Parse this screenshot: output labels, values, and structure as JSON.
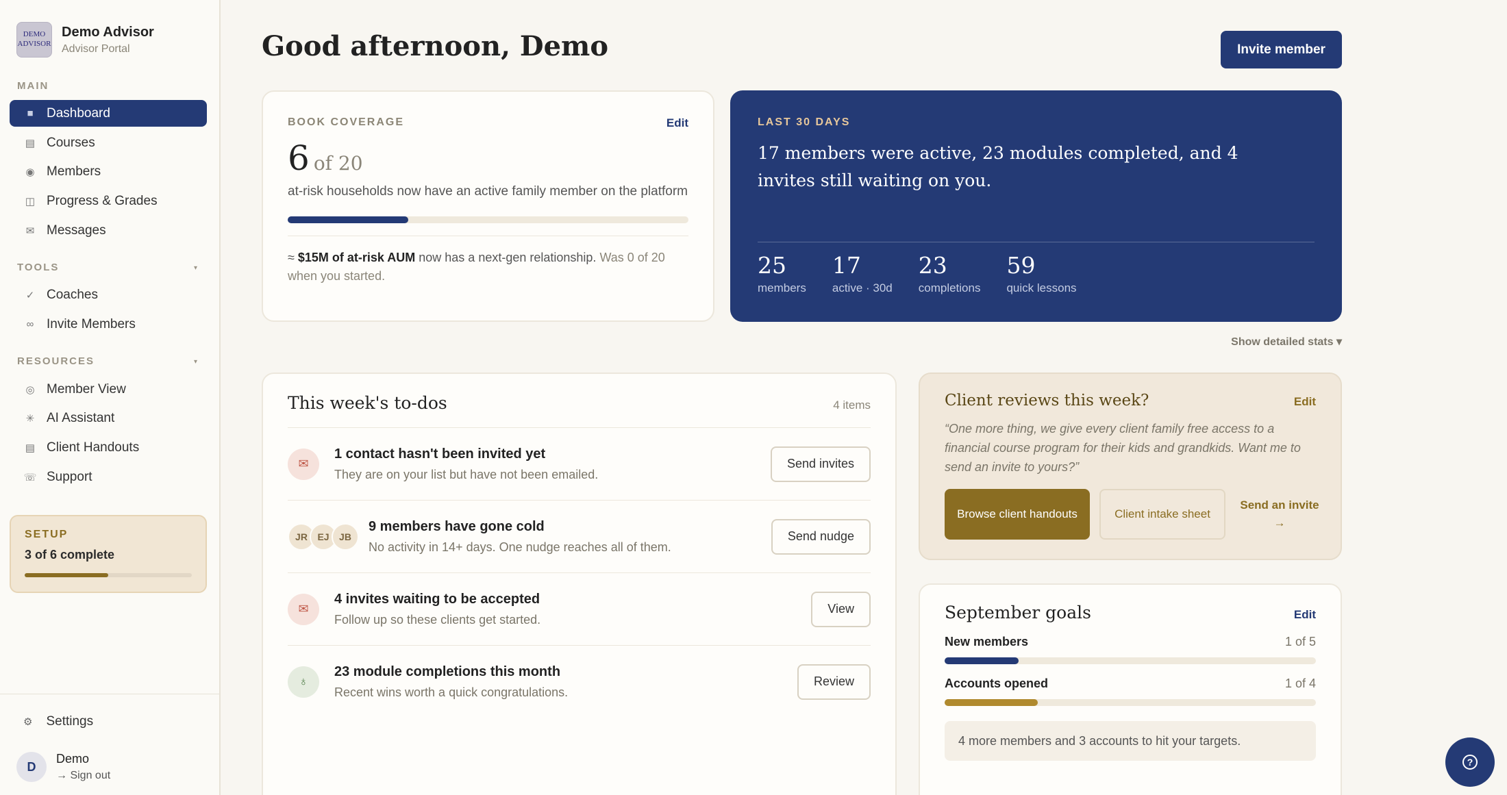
{
  "brand": {
    "logo_text": "DEMO ADVISOR",
    "name": "Demo Advisor",
    "subtitle": "Advisor Portal"
  },
  "sidebar": {
    "main_label": "MAIN",
    "main_items": [
      {
        "label": "Dashboard",
        "icon": "dashboard-icon",
        "active": true
      },
      {
        "label": "Courses",
        "icon": "courses-icon"
      },
      {
        "label": "Members",
        "icon": "members-icon"
      },
      {
        "label": "Progress & Grades",
        "icon": "progress-icon"
      },
      {
        "label": "Messages",
        "icon": "mail-icon"
      }
    ],
    "tools_label": "TOOLS",
    "tools_items": [
      {
        "label": "Coaches",
        "icon": "check-icon"
      },
      {
        "label": "Invite Members",
        "icon": "link-icon"
      }
    ],
    "resources_label": "RESOURCES",
    "resources_items": [
      {
        "label": "Member View",
        "icon": "circle-icon"
      },
      {
        "label": "AI Assistant",
        "icon": "sparkle-icon"
      },
      {
        "label": "Client Handouts",
        "icon": "document-icon"
      },
      {
        "label": "Support",
        "icon": "phone-icon"
      }
    ],
    "setup": {
      "title": "SETUP",
      "count": "3 of 6 complete",
      "progress": 0.5
    },
    "settings_label": "Settings",
    "user": {
      "initial": "D",
      "name": "Demo",
      "signout": "Sign out"
    }
  },
  "header": {
    "greeting": "Good afternoon, Demo",
    "invite_button": "Invite member"
  },
  "coverage": {
    "label": "BOOK COVERAGE",
    "edit": "Edit",
    "value": "6",
    "of_text": "of 20",
    "description": "at-risk households now have an active family member on the platform",
    "progress": 0.3,
    "note_prefix": "≈ ",
    "note_bold": "$15M of at-risk AUM",
    "note_mid": " now has a next-gen relationship. ",
    "note_muted": "Was 0 of 20 when you started."
  },
  "last30": {
    "label": "LAST 30 DAYS",
    "summary": "17 members were active, 23 modules completed, and 4 invites still waiting on you.",
    "stats": [
      {
        "value": "25",
        "label": "members"
      },
      {
        "value": "17",
        "label": "active · 30d"
      },
      {
        "value": "23",
        "label": "completions"
      },
      {
        "value": "59",
        "label": "quick lessons"
      }
    ]
  },
  "show_stats": "Show detailed stats ▾",
  "todos": {
    "title": "This week's to-dos",
    "count": "4 items",
    "items": [
      {
        "title": "1 contact hasn't been invited yet",
        "sub": "They are on your list but have not been emailed.",
        "button": "Send invites"
      },
      {
        "title": "9 members have gone cold",
        "sub": "No activity in 14+ days. One nudge reaches all of them.",
        "button": "Send nudge",
        "avatars": [
          "JR",
          "EJ",
          "JB"
        ]
      },
      {
        "title": "4 invites waiting to be accepted",
        "sub": "Follow up so these clients get started.",
        "button": "View"
      },
      {
        "title": "23 module completions this month",
        "sub": "Recent wins worth a quick congratulations.",
        "button": "Review"
      }
    ]
  },
  "reviews": {
    "title": "Client reviews this week?",
    "edit": "Edit",
    "quote": "“One more thing, we give every client family free access to a financial course program for their kids and grandkids. Want me to send an invite to yours?”",
    "btn_handouts": "Browse client handouts",
    "btn_intake": "Client intake sheet",
    "link_invite": "Send an invite →"
  },
  "goals": {
    "title": "September goals",
    "edit": "Edit",
    "items": [
      {
        "name": "New members",
        "value": "1 of 5",
        "progress": 0.2,
        "color": "#243a75"
      },
      {
        "name": "Accounts opened",
        "value": "1 of 4",
        "progress": 0.25,
        "color": "#b08a2e"
      }
    ],
    "note": "4 more members and 3 accounts to hit your targets."
  },
  "help_icon": "help-icon"
}
